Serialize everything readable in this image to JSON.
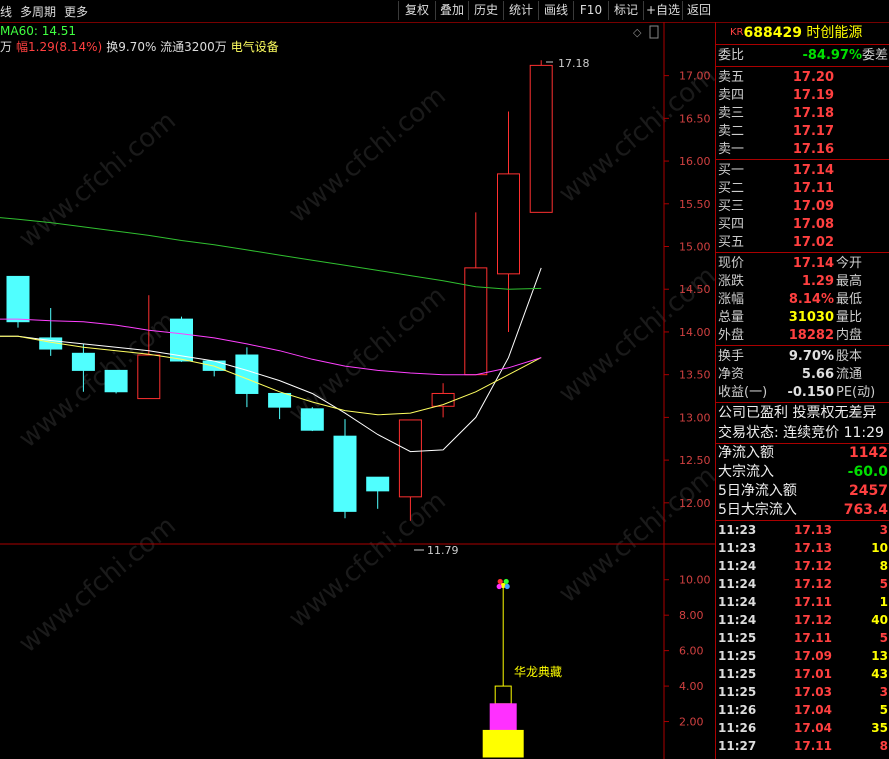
{
  "toolbar": {
    "left_tabs": [
      "线",
      "多周期",
      "更多"
    ],
    "buttons": [
      "复权",
      "叠加",
      "历史",
      "统计",
      "画线",
      "F10",
      "标记",
      "+自选",
      "返回"
    ]
  },
  "info_line": {
    "ma60": "MA60: 14.51",
    "prefix": "万",
    "change_label": "幅",
    "change_value": "1.29(8.14%)",
    "turnover": "换9.70% 流通3200万",
    "industry": "电气设备"
  },
  "price_chart": {
    "y_ticks": [
      "17.00",
      "16.50",
      "16.00",
      "15.50",
      "15.00",
      "14.50",
      "14.00",
      "13.50",
      "13.00",
      "12.50",
      "12.00"
    ],
    "high_marker": "17.18",
    "low_marker": "11.79"
  },
  "indicator": {
    "y_ticks": [
      "10.00",
      "8.00",
      "6.00",
      "4.00",
      "2.00"
    ],
    "label": "华龙典藏"
  },
  "watermark": "www.cfchi.com",
  "quote": {
    "tag": "KR",
    "code": "688429",
    "name": "时创能源",
    "weibi_label": "委比",
    "weibi_value": "-84.97%",
    "weicha_label": "委差",
    "asks": [
      {
        "label": "卖五",
        "price": "17.20"
      },
      {
        "label": "卖四",
        "price": "17.19"
      },
      {
        "label": "卖三",
        "price": "17.18"
      },
      {
        "label": "卖二",
        "price": "17.17"
      },
      {
        "label": "卖一",
        "price": "17.16"
      }
    ],
    "bids": [
      {
        "label": "买一",
        "price": "17.14"
      },
      {
        "label": "买二",
        "price": "17.11"
      },
      {
        "label": "买三",
        "price": "17.09"
      },
      {
        "label": "买四",
        "price": "17.08"
      },
      {
        "label": "买五",
        "price": "17.02"
      }
    ],
    "stats": [
      {
        "label": "现价",
        "value": "17.14",
        "ext": "今开"
      },
      {
        "label": "涨跌",
        "value": "1.29",
        "ext": "最高"
      },
      {
        "label": "涨幅",
        "value": "8.14%",
        "ext": "最低"
      },
      {
        "label": "总量",
        "value": "31030",
        "ext": "量比"
      },
      {
        "label": "外盘",
        "value": "18282",
        "ext": "内盘"
      }
    ],
    "stats2": [
      {
        "label": "换手",
        "value": "9.70%",
        "ext": "股本"
      },
      {
        "label": "净资",
        "value": "5.66",
        "ext": "流通"
      },
      {
        "label": "收益(一)",
        "value": "-0.150",
        "ext": "PE(动)"
      }
    ],
    "notice": "公司已盈利 投票权无差异",
    "trade_status": "交易状态: 连续竞价 11:29",
    "flows": [
      {
        "label": "净流入额",
        "value": "1142"
      },
      {
        "label": "大宗流入",
        "value": "-60.0"
      },
      {
        "label": "5日净流入额",
        "value": "2457"
      },
      {
        "label": "5日大宗流入",
        "value": "763.4"
      }
    ],
    "ticks": [
      {
        "time": "11:23",
        "price": "17.13",
        "vol": "3"
      },
      {
        "time": "11:23",
        "price": "17.13",
        "vol": "10"
      },
      {
        "time": "11:24",
        "price": "17.12",
        "vol": "8"
      },
      {
        "time": "11:24",
        "price": "17.12",
        "vol": "5"
      },
      {
        "time": "11:24",
        "price": "17.11",
        "vol": "1"
      },
      {
        "time": "11:24",
        "price": "17.12",
        "vol": "40"
      },
      {
        "time": "11:25",
        "price": "17.11",
        "vol": "5"
      },
      {
        "time": "11:25",
        "price": "17.09",
        "vol": "13"
      },
      {
        "time": "11:25",
        "price": "17.01",
        "vol": "43"
      },
      {
        "time": "11:25",
        "price": "17.03",
        "vol": "3"
      },
      {
        "time": "11:26",
        "price": "17.04",
        "vol": "5"
      },
      {
        "time": "11:26",
        "price": "17.04",
        "vol": "35"
      },
      {
        "time": "11:27",
        "price": "17.11",
        "vol": "8"
      }
    ]
  },
  "chart_data": {
    "type": "candlestick",
    "ylim": [
      11.6,
      17.3
    ],
    "candles": [
      {
        "o": 14.65,
        "c": 14.12,
        "h": 14.65,
        "l": 14.05
      },
      {
        "o": 13.93,
        "c": 13.8,
        "h": 14.28,
        "l": 13.72
      },
      {
        "o": 13.75,
        "c": 13.55,
        "h": 13.86,
        "l": 13.3
      },
      {
        "o": 13.55,
        "c": 13.3,
        "h": 13.55,
        "l": 13.28
      },
      {
        "o": 13.22,
        "c": 13.73,
        "h": 14.43,
        "l": 13.22
      },
      {
        "o": 14.15,
        "c": 13.66,
        "h": 14.18,
        "l": 13.65
      },
      {
        "o": 13.66,
        "c": 13.55,
        "h": 13.66,
        "l": 13.48
      },
      {
        "o": 13.73,
        "c": 13.28,
        "h": 13.82,
        "l": 13.12
      },
      {
        "o": 13.28,
        "c": 13.12,
        "h": 13.28,
        "l": 12.98
      },
      {
        "o": 13.1,
        "c": 12.85,
        "h": 13.12,
        "l": 12.84
      },
      {
        "o": 12.78,
        "c": 11.9,
        "h": 12.98,
        "l": 11.82
      },
      {
        "o": 12.3,
        "c": 12.14,
        "h": 12.3,
        "l": 11.93
      },
      {
        "o": 12.07,
        "c": 12.97,
        "h": 12.97,
        "l": 11.79
      },
      {
        "o": 13.13,
        "c": 13.28,
        "h": 13.4,
        "l": 13.0
      },
      {
        "o": 13.5,
        "c": 14.75,
        "h": 15.4,
        "l": 13.5
      },
      {
        "o": 14.68,
        "c": 15.85,
        "h": 16.58,
        "l": 14.0
      },
      {
        "o": 15.4,
        "c": 17.12,
        "h": 17.18,
        "l": 15.4
      }
    ],
    "series": [
      {
        "color": "#ffffff",
        "values": [
          13.95,
          13.9,
          13.86,
          13.82,
          13.78,
          13.72,
          13.66,
          13.55,
          13.43,
          13.28,
          13.05,
          12.8,
          12.6,
          12.62,
          13.0,
          13.7,
          14.75
        ]
      },
      {
        "color": "#ffff60",
        "values": [
          13.95,
          13.88,
          13.82,
          13.78,
          13.74,
          13.68,
          13.6,
          13.45,
          13.3,
          13.18,
          13.08,
          13.03,
          13.05,
          13.15,
          13.3,
          13.5,
          13.7
        ]
      },
      {
        "color": "#ff40ff",
        "values": [
          14.15,
          14.13,
          14.12,
          14.08,
          14.02,
          13.98,
          13.93,
          13.86,
          13.78,
          13.68,
          13.6,
          13.55,
          13.52,
          13.5,
          13.5,
          13.58,
          13.7
        ]
      },
      {
        "color": "#30c030",
        "values": [
          15.32,
          15.28,
          15.23,
          15.18,
          15.13,
          15.07,
          15.02,
          14.96,
          14.9,
          14.84,
          14.78,
          14.72,
          14.66,
          14.6,
          14.53,
          14.5,
          14.51
        ]
      }
    ],
    "indicator_ylim": [
      0,
      11
    ],
    "indicator_bars": [
      {
        "value": 4.0,
        "color": "#ffff00"
      },
      {
        "value": 3.0,
        "color": "#ff30ff"
      },
      {
        "value": 1.5,
        "color": "#ffff00"
      }
    ]
  }
}
